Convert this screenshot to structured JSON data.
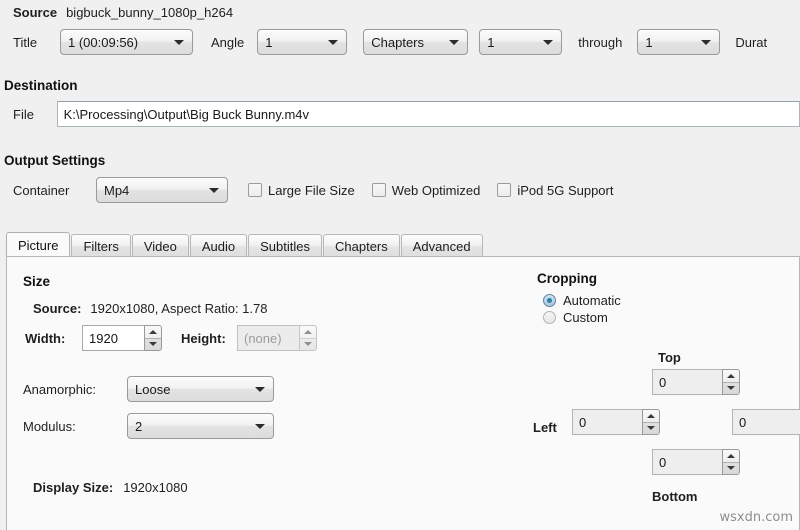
{
  "source": {
    "label": "Source",
    "value": "bigbuck_bunny_1080p_h264",
    "title_label": "Title",
    "title_value": "1 (00:09:56)",
    "angle_label": "Angle",
    "angle_value": "1",
    "range_type_value": "Chapters",
    "range_start_value": "1",
    "through_label": "through",
    "range_end_value": "1",
    "duration_label": "Durat"
  },
  "destination": {
    "heading": "Destination",
    "file_label": "File",
    "file_value": "K:\\Processing\\Output\\Big Buck Bunny.m4v"
  },
  "output_settings": {
    "heading": "Output Settings",
    "container_label": "Container",
    "container_value": "Mp4",
    "checkboxes": [
      {
        "label": "Large File Size",
        "checked": false
      },
      {
        "label": "Web Optimized",
        "checked": false
      },
      {
        "label": "iPod 5G Support",
        "checked": false
      }
    ]
  },
  "tabs": [
    {
      "label": "Picture",
      "active": true
    },
    {
      "label": "Filters",
      "active": false
    },
    {
      "label": "Video",
      "active": false
    },
    {
      "label": "Audio",
      "active": false
    },
    {
      "label": "Subtitles",
      "active": false
    },
    {
      "label": "Chapters",
      "active": false
    },
    {
      "label": "Advanced",
      "active": false
    }
  ],
  "picture": {
    "size_heading": "Size",
    "source_label": "Source:",
    "source_value": "1920x1080, Aspect Ratio: 1.78",
    "width_label": "Width:",
    "width_value": "1920",
    "height_label": "Height:",
    "height_value": "(none)",
    "anamorphic_label": "Anamorphic:",
    "anamorphic_value": "Loose",
    "modulus_label": "Modulus:",
    "modulus_value": "2",
    "display_size_label": "Display Size:",
    "display_size_value": "1920x1080"
  },
  "cropping": {
    "heading": "Cropping",
    "mode_automatic": "Automatic",
    "mode_custom": "Custom",
    "selected_mode": "Automatic",
    "top_label": "Top",
    "top_value": "0",
    "left_label": "Left",
    "left_value": "0",
    "right_value": "0",
    "bottom_label": "Bottom",
    "bottom_value": "0"
  },
  "watermark": "wsxdn.com",
  "colors": {
    "window_bg": "#f0f0f0",
    "panel_bg": "#fafafa",
    "radio_accent": "#2f7fad",
    "text": "#1a1a1a"
  }
}
